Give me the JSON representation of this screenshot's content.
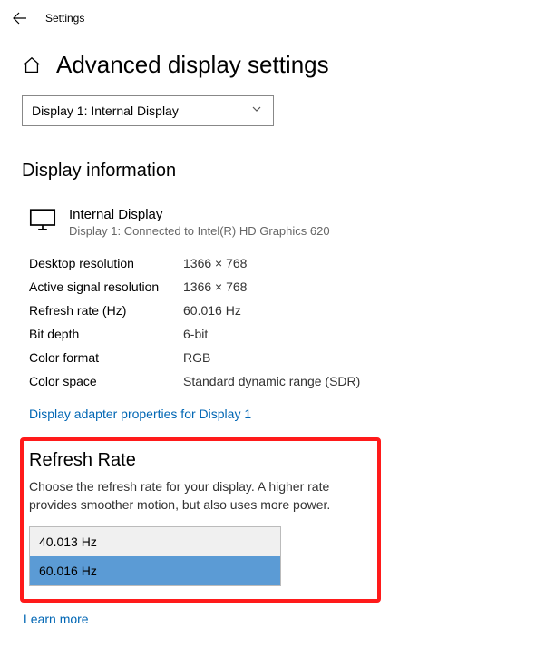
{
  "titlebar": {
    "title": "Settings"
  },
  "header": {
    "page_title": "Advanced display settings"
  },
  "dropdown": {
    "selected": "Display 1: Internal Display"
  },
  "section": {
    "heading": "Display information"
  },
  "display": {
    "name": "Internal Display",
    "sub": "Display 1: Connected to Intel(R) HD Graphics 620"
  },
  "rows": [
    {
      "label": "Desktop resolution",
      "value": "1366 × 768"
    },
    {
      "label": "Active signal resolution",
      "value": "1366 × 768"
    },
    {
      "label": "Refresh rate (Hz)",
      "value": "60.016 Hz"
    },
    {
      "label": "Bit depth",
      "value": "6-bit"
    },
    {
      "label": "Color format",
      "value": "RGB"
    },
    {
      "label": "Color space",
      "value": "Standard dynamic range (SDR)"
    }
  ],
  "adapter_link": "Display adapter properties for Display 1",
  "refresh": {
    "heading": "Refresh Rate",
    "desc": "Choose the refresh rate for your display. A higher rate provides smoother motion, but also uses more power.",
    "options": [
      {
        "label": "40.013 Hz",
        "selected": false
      },
      {
        "label": "60.016 Hz",
        "selected": true
      }
    ]
  },
  "learn_more": "Learn more"
}
